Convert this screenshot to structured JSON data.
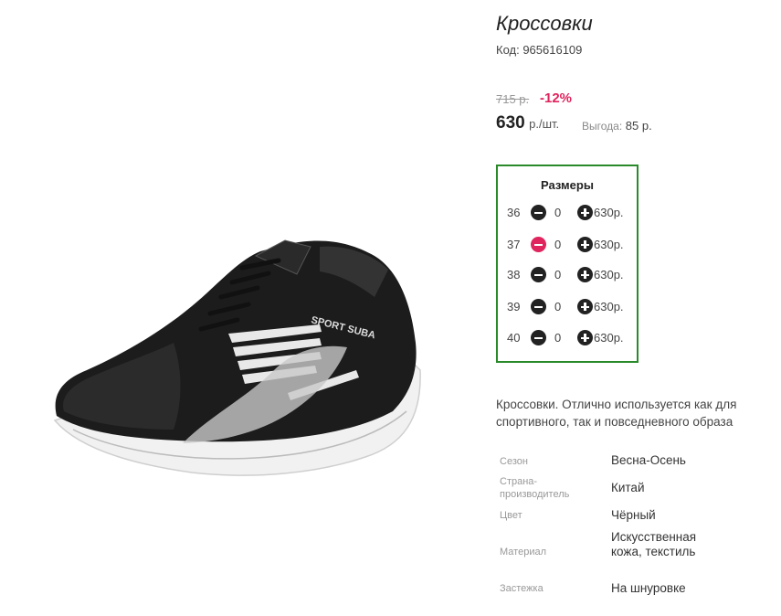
{
  "product": {
    "title": "Кроссовки",
    "code": "Код: 965616109",
    "old_price": "715 р.",
    "discount": "-12%",
    "price": "630",
    "unit": "р./шт.",
    "saving_label": "Выгода:",
    "saving_value": "85 р."
  },
  "sizes": {
    "title": "Размеры",
    "rows": [
      {
        "size": "36",
        "qty": "0",
        "price": "630р.",
        "minus_active": false
      },
      {
        "size": "37",
        "qty": "0",
        "price": "630р.",
        "minus_active": true
      },
      {
        "size": "38",
        "qty": "0",
        "price": "630р.",
        "minus_active": false
      },
      {
        "size": "39",
        "qty": "0",
        "price": "630р.",
        "minus_active": false
      },
      {
        "size": "40",
        "qty": "0",
        "price": "630р.",
        "minus_active": false
      }
    ]
  },
  "description": "Кроссовки. Отлично используется как для спортивного, так и повседневного образа",
  "properties": [
    {
      "label": "Сезон",
      "value": "Весна-Осень"
    },
    {
      "label": "Страна-производитель",
      "value": "Китай"
    },
    {
      "label": "Цвет",
      "value": "Чёрный"
    },
    {
      "label": "Материал",
      "value": "Искусственная кожа, текстиль"
    },
    {
      "label": "Застежка",
      "value": "На шнуровке"
    }
  ],
  "photo": {
    "brand_text": "SPORT SUBA"
  },
  "colors": {
    "accent_border": "#2a8a2a",
    "discount": "#e0245e",
    "minus_active": "#e0245e"
  }
}
